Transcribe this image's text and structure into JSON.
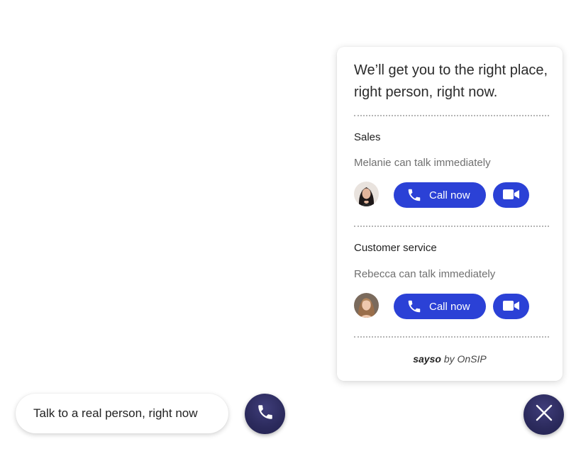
{
  "panel": {
    "headline_line1": "We’ll get you to the right place,",
    "headline_line2": "right person, right now.",
    "sections": [
      {
        "department": "Sales",
        "availability": "Melanie can talk immediately",
        "call_label": "Call now"
      },
      {
        "department": "Customer service",
        "availability": "Rebecca can talk immediately",
        "call_label": "Call now"
      }
    ],
    "brand_bold": "sayso",
    "brand_rest": " by OnSIP"
  },
  "launcher": {
    "pill_text": "Talk to a real person, right now"
  },
  "icons": {
    "call": "phone-icon",
    "video": "video-camera-icon",
    "close": "close-icon"
  },
  "colors": {
    "accent": "#2b41d6",
    "fab": "#2b2a5c",
    "divider": "#b5b5b5"
  }
}
